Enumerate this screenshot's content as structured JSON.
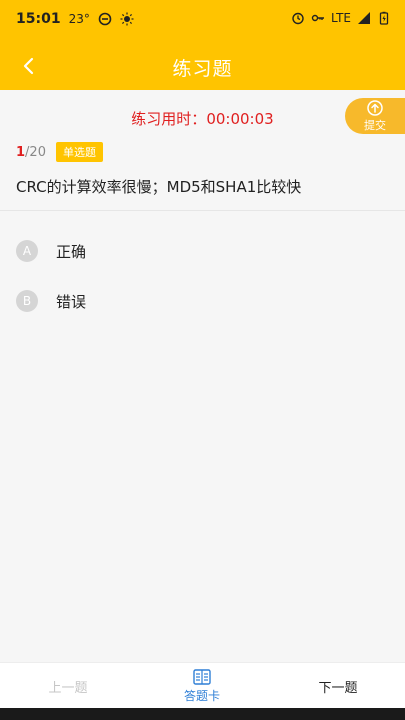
{
  "status": {
    "time": "15:01",
    "temp": "23°",
    "network": "LTE"
  },
  "nav": {
    "title": "练习题"
  },
  "timer": {
    "label": "练习用时：",
    "value": "00:00:03"
  },
  "submit": {
    "label": "提交"
  },
  "question": {
    "current": "1",
    "total": "/20",
    "type": "单选题",
    "text": "CRC的计算效率很慢；MD5和SHA1比较快"
  },
  "options": [
    {
      "letter": "A",
      "text": "正确"
    },
    {
      "letter": "B",
      "text": "错误"
    }
  ],
  "bottom": {
    "prev": "上一题",
    "card": "答题卡",
    "next": "下一题"
  },
  "colors": {
    "brand": "#ffc400",
    "timer": "#e02020",
    "card_active": "#2f7fd6"
  }
}
